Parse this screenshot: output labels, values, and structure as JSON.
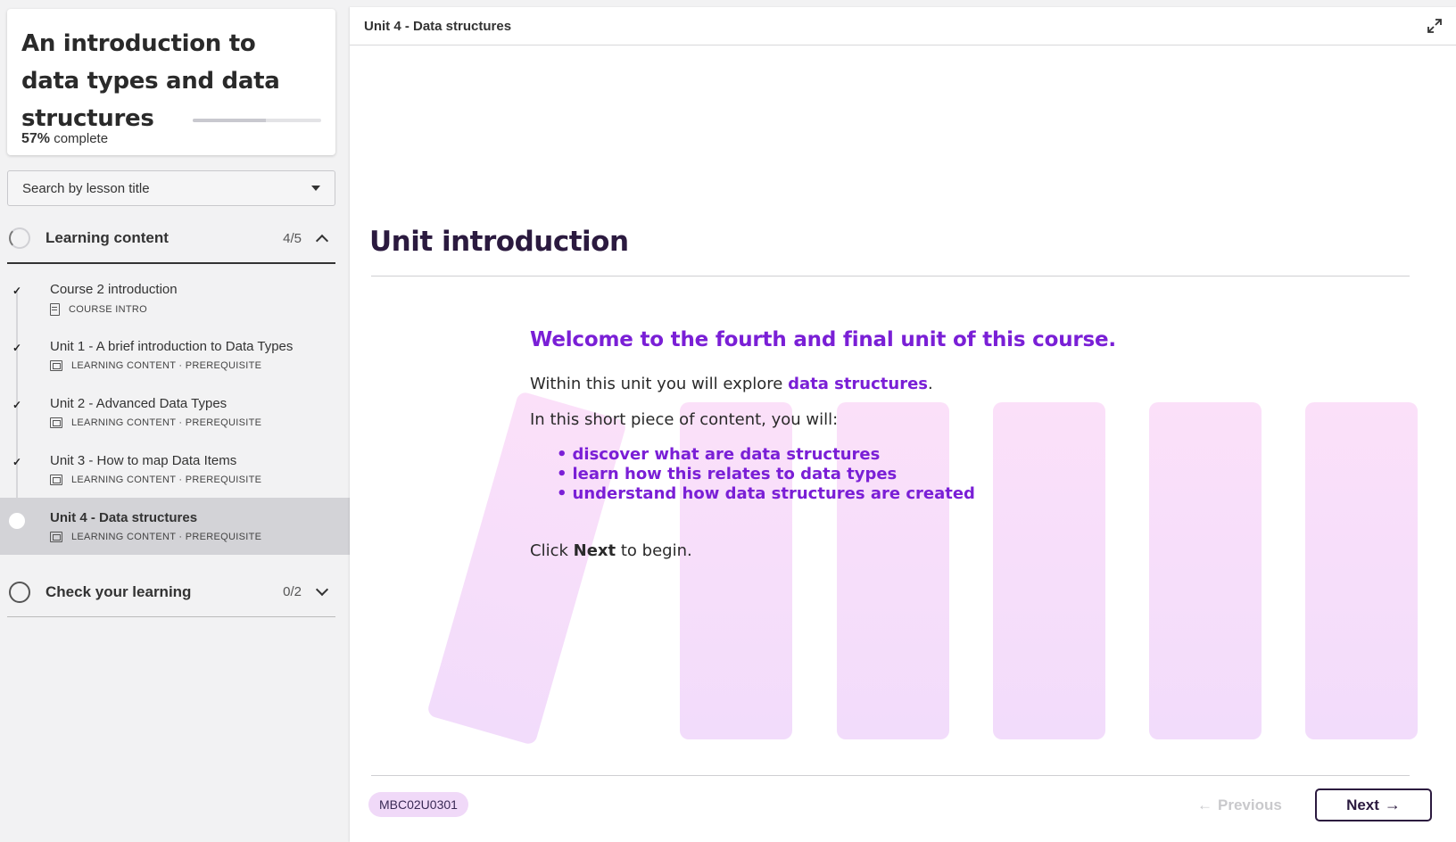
{
  "course": {
    "title": "An introduction to data types and data structures",
    "progress_percent": "57%",
    "progress_suffix": " complete",
    "progress_value": 0.57
  },
  "search": {
    "placeholder": "Search by lesson title"
  },
  "sections": {
    "learning": {
      "label": "Learning content",
      "count": "4/5"
    },
    "check": {
      "label": "Check your learning",
      "count": "0/2"
    }
  },
  "lessons": [
    {
      "title": "Course 2 introduction",
      "meta": "COURSE INTRO",
      "done": true,
      "icon": "document-icon"
    },
    {
      "title": "Unit 1 - A brief introduction to Data Types",
      "meta": "LEARNING CONTENT · PREREQUISITE",
      "done": true,
      "icon": "slides-icon"
    },
    {
      "title": "Unit 2 - Advanced Data Types",
      "meta": "LEARNING CONTENT · PREREQUISITE",
      "done": true,
      "icon": "slides-icon"
    },
    {
      "title": "Unit 3 - How to map Data Items",
      "meta": "LEARNING CONTENT · PREREQUISITE",
      "done": true,
      "icon": "slides-icon"
    },
    {
      "title": "Unit 4 - Data structures",
      "meta": "LEARNING CONTENT · PREREQUISITE",
      "done": false,
      "active": true,
      "icon": "slides-icon"
    }
  ],
  "main": {
    "breadcrumb": "Unit 4 - Data structures",
    "heading": "Unit introduction",
    "welcome": "Welcome to the fourth and final unit of this course.",
    "para1_prefix": "Within this unit you will explore ",
    "para1_highlight": "data structures",
    "para1_suffix": ".",
    "para2": "In this short piece of content, you will:",
    "bullets": [
      "discover what are data structures",
      "learn how this relates to data types",
      "understand how data structures are created"
    ],
    "click_prefix": "Click ",
    "click_bold": "Next",
    "click_suffix": " to begin.",
    "code": "MBC02U0301",
    "prev_label": "Previous",
    "next_label": "Next"
  },
  "colors": {
    "accent": "#7a1fd6",
    "heading": "#2b1a3f",
    "badge_bg": "#f0d9f8"
  }
}
